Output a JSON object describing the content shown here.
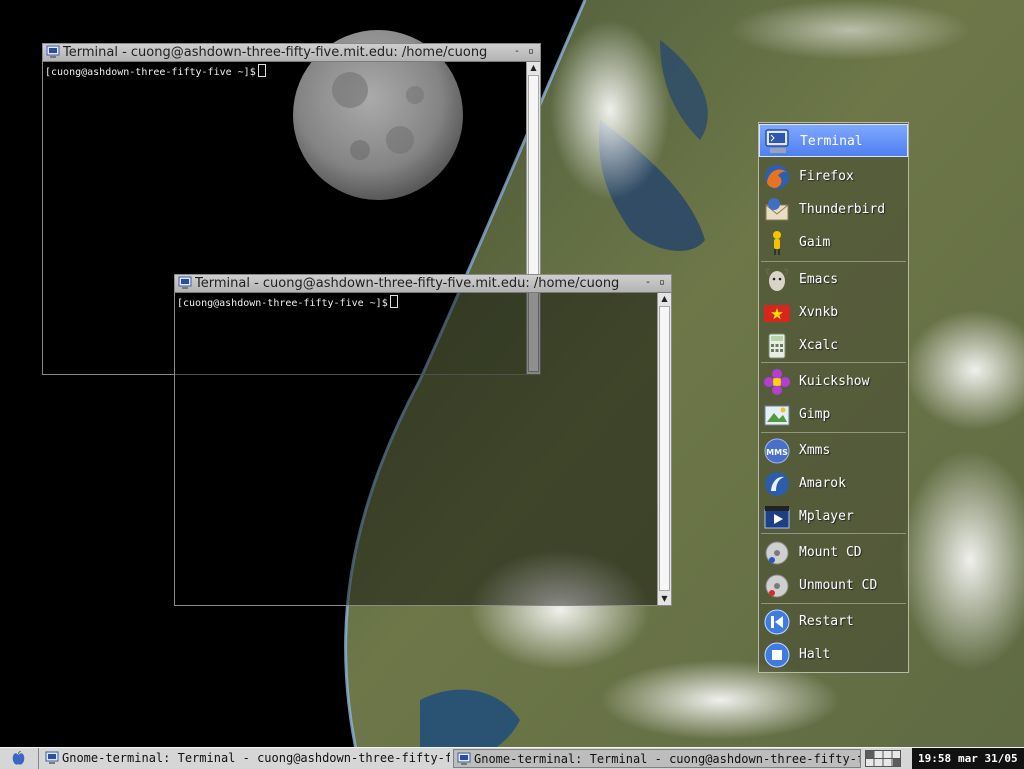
{
  "desktop": {
    "colors": {
      "space": "#000000",
      "moon": "#8a8a8a",
      "earth_land": "#6e7a4a",
      "clouds": "#e8ecef",
      "sea": "#1e4d7a"
    }
  },
  "windows": [
    {
      "title": "Terminal - cuong@ashdown-three-fifty-five.mit.edu: /home/cuong",
      "prompt": "[cuong@ashdown-three-fifty-five ~]$",
      "icon": "terminal-icon",
      "buttons": {
        "minimize": "-",
        "maximize": "▫"
      },
      "scroll_up": "▲"
    },
    {
      "title": "Terminal - cuong@ashdown-three-fifty-five.mit.edu: /home/cuong",
      "prompt": "[cuong@ashdown-three-fifty-five ~]$",
      "icon": "terminal-icon",
      "buttons": {
        "minimize": "-",
        "maximize": "▫"
      },
      "scroll_up": "▲",
      "scroll_down": "▼"
    }
  ],
  "launcher": {
    "items": [
      {
        "label": "Terminal",
        "icon": "terminal-icon",
        "selected": true
      },
      {
        "label": "Firefox",
        "icon": "firefox-icon"
      },
      {
        "label": "Thunderbird",
        "icon": "thunderbird-icon"
      },
      {
        "label": "Gaim",
        "icon": "gaim-icon"
      },
      {
        "label": "Emacs",
        "icon": "emacs-icon"
      },
      {
        "label": "Xvnkb",
        "icon": "xvnkb-flag-icon"
      },
      {
        "label": "Xcalc",
        "icon": "calculator-icon"
      },
      {
        "label": "Kuickshow",
        "icon": "kuickshow-icon"
      },
      {
        "label": "Gimp",
        "icon": "gimp-icon"
      },
      {
        "label": "Xmms",
        "icon": "xmms-icon"
      },
      {
        "label": "Amarok",
        "icon": "amarok-icon"
      },
      {
        "label": "Mplayer",
        "icon": "mplayer-icon"
      },
      {
        "label": "Mount CD",
        "icon": "cd-mount-icon"
      },
      {
        "label": "Unmount CD",
        "icon": "cd-unmount-icon"
      },
      {
        "label": "Restart",
        "icon": "restart-icon"
      },
      {
        "label": "Halt",
        "icon": "halt-icon"
      }
    ]
  },
  "taskbar": {
    "start_icon": "apple-icon",
    "tasks": [
      {
        "label": "Gnome-terminal: Terminal - cuong@ashdown-three-fifty-five.mit.edu: /home/cuong",
        "active": false
      },
      {
        "label": "Gnome-terminal: Terminal - cuong@ashdown-three-fifty-five.mit.edu: /home/cuong",
        "active": true
      }
    ],
    "clock": {
      "time": "19:58",
      "date": "mar 31/05"
    }
  }
}
